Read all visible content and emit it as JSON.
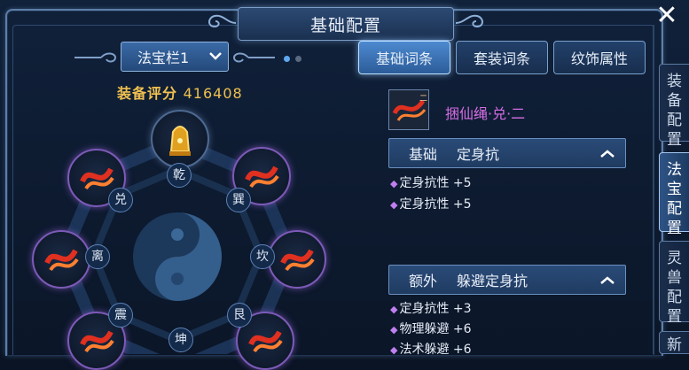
{
  "window": {
    "title": "基础配置",
    "close_icon": "close-icon"
  },
  "dropdown": {
    "label": "法宝栏1",
    "icon": "chevron-down-icon"
  },
  "pager": {
    "pages": 2,
    "current": 1
  },
  "score": {
    "label": "装备评分",
    "value": "416408"
  },
  "bagua": {
    "trigrams": [
      "乾",
      "巽",
      "坎",
      "艮",
      "坤",
      "震",
      "离",
      "兑"
    ],
    "center_icon": "taiji-icon"
  },
  "tabs": [
    {
      "label": "基础词条",
      "active": true
    },
    {
      "label": "套装词条",
      "active": false
    },
    {
      "label": "纹饰属性",
      "active": false
    }
  ],
  "item": {
    "name": "捆仙绳·兑·二",
    "icon": "rope-icon"
  },
  "sections": [
    {
      "key": "基础",
      "value": "定身抗",
      "attrs": [
        "定身抗性 +5",
        "定身抗性 +5"
      ]
    },
    {
      "key": "额外",
      "value": "躲避定身抗",
      "attrs": [
        "定身抗性 +3",
        "物理躲避 +6",
        "法术躲避 +6"
      ]
    }
  ],
  "side_tabs": [
    {
      "label": "装备配置",
      "active": false
    },
    {
      "label": "法宝配置",
      "active": true
    },
    {
      "label": "灵兽配置",
      "active": false
    },
    {
      "label": "新",
      "active": false
    }
  ],
  "colors": {
    "accent": "#4d8ad0",
    "purple_text": "#d56de3",
    "gold_text": "#f0c050"
  }
}
